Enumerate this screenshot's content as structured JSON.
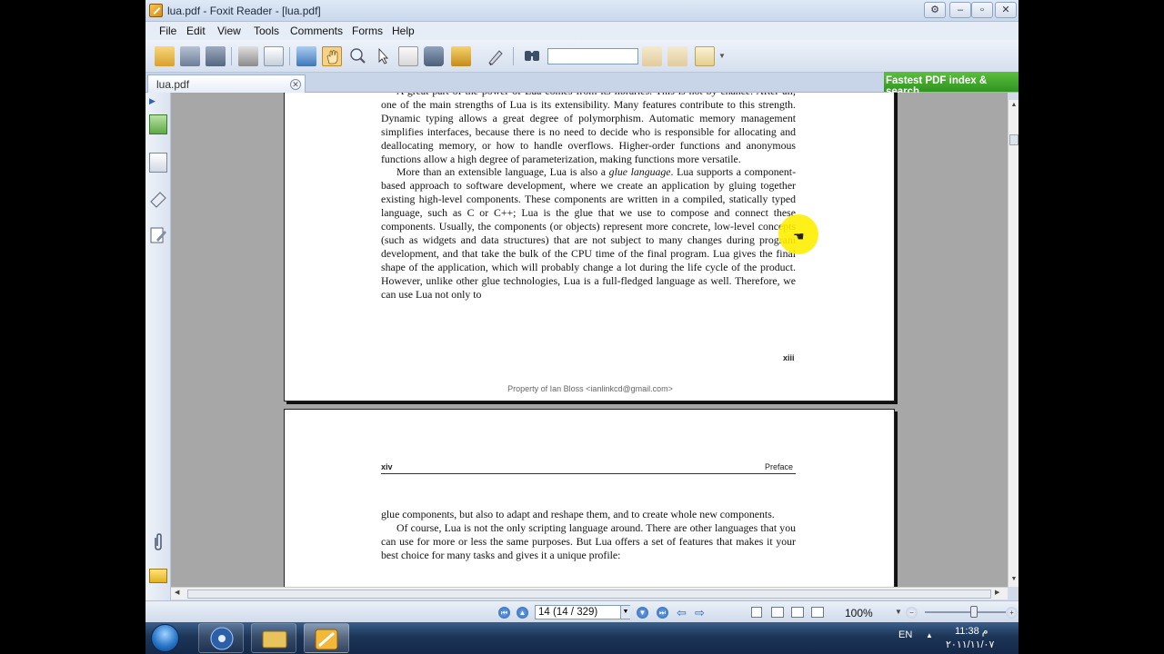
{
  "window": {
    "title": "lua.pdf - Foxit Reader - [lua.pdf]",
    "controls": {
      "restore_small": "⚙",
      "minimize": "–",
      "maximize": "▫",
      "close": "✕"
    }
  },
  "menu": [
    "File",
    "Edit",
    "View",
    "Tools",
    "Comments",
    "Forms",
    "Help"
  ],
  "toolbar": {
    "icons": [
      "open-icon",
      "save-icon",
      "save-all-icon",
      "print-icon",
      "email-icon",
      "fullscreen-icon",
      "hand-tool-icon",
      "zoom-tool-icon",
      "select-tool-icon",
      "text-select-icon",
      "snapshot-icon",
      "rms-icon",
      "typewriter-icon",
      "find-icon",
      "prev-result-icon",
      "next-result-icon",
      "highlight-icon"
    ],
    "search_value": ""
  },
  "tabs": [
    {
      "label": "lua.pdf"
    }
  ],
  "ad_banner": "Fastest PDF index & search",
  "document": {
    "page1": {
      "paragraph_a": "A great part of the power of Lua comes from its libraries. This is not by chance. After all, one of the main strengths of Lua is its extensibility. Many features contribute to this strength. Dynamic typing allows a great degree of polymorphism. Automatic memory management simplifies interfaces, because there is no need to decide who is responsible for allocating and deallocating memory, or how to handle overflows. Higher-order functions and anonymous functions allow a high degree of parameterization, making functions more versatile.",
      "paragraph_b_start": "More than an extensible language, Lua is also a ",
      "paragraph_b_emph": "glue language",
      "paragraph_b_rest": ". Lua supports a component-based approach to software development, where we create an application by gluing together existing high-level components. These components are written in a compiled, statically typed language, such as C or C++; Lua is the glue that we use to compose and connect these components. Usually, the components (or objects) represent more concrete, low-level concepts (such as widgets and data structures) that are not subject to many changes during program development, and that take the bulk of the CPU time of the final program. Lua gives the final shape of the application, which will probably change a lot during the life cycle of the product. However, unlike other glue technologies, Lua is a full-fledged language as well. Therefore, we can use Lua not only to",
      "page_number": "xiii",
      "watermark": "Property of Ian Bloss <ianlinkcd@gmail.com>"
    },
    "page2": {
      "header_left": "xiv",
      "header_right": "Preface",
      "paragraph_a": "glue components, but also to adapt and reshape them, and to create whole new components.",
      "paragraph_b": "Of course, Lua is not the only scripting language around. There are other languages that you can use for more or less the same purposes. But Lua offers a set of features that makes it your best choice for many tasks and gives it a unique profile:"
    }
  },
  "status": {
    "page_field": "14 (14 / 329)",
    "zoom": "100%",
    "zoom_level": 0.6
  },
  "taskbar": {
    "language": "EN",
    "time": "11:38 م",
    "date": "٢٠١١/١١/٠٧"
  },
  "colors": {
    "highlight_cursor": "#ffee00",
    "ad_green": "#3aa02a",
    "accent_blue": "#2b63b5"
  }
}
